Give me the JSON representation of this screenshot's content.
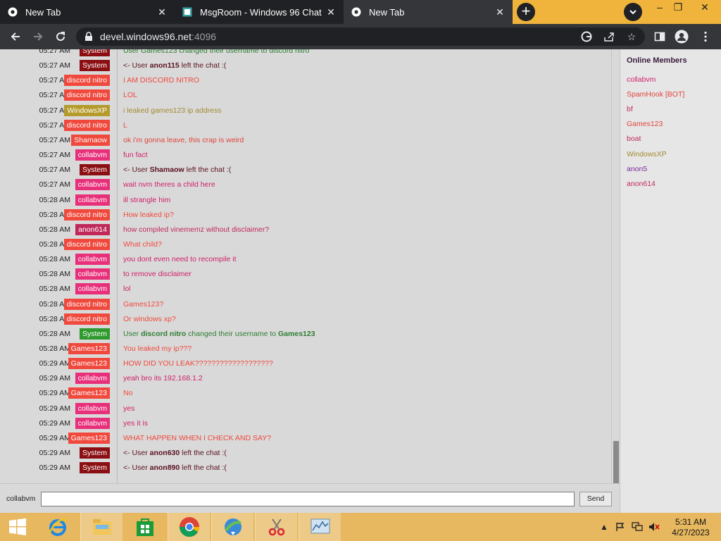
{
  "browser": {
    "tabs": [
      {
        "label": "New Tab",
        "active": false
      },
      {
        "label": "MsgRoom - Windows 96 Chat",
        "active": false
      },
      {
        "label": "New Tab",
        "active": true
      }
    ],
    "url_host": "devel.windows96.net",
    "url_port": ":4096"
  },
  "chat": {
    "messages": [
      {
        "time": "05:27 AM",
        "user": "System",
        "user_color": "#8b0e12",
        "text": "User Games123 changed their username to discord nitro",
        "text_color": "#2e7d32",
        "partial": true
      },
      {
        "time": "05:27 AM",
        "user": "System",
        "user_color": "#8b0e12",
        "pre": "<- User ",
        "bold": "anon115",
        "post": " left the chat :(",
        "text_color": "#5a1020"
      },
      {
        "time": "05:27 AM",
        "user": "discord nitro",
        "user_color": "#f0483c",
        "text": "I AM DISCORD NITRO",
        "text_color": "#f0483c"
      },
      {
        "time": "05:27 AM",
        "user": "discord nitro",
        "user_color": "#f0483c",
        "text": "LOL",
        "text_color": "#f0483c"
      },
      {
        "time": "05:27 AM",
        "user": "WindowsXP",
        "user_color": "#b59a2c",
        "text": "i leaked games123 ip address",
        "text_color": "#a08a30"
      },
      {
        "time": "05:27 AM",
        "user": "discord nitro",
        "user_color": "#f0483c",
        "text": "L",
        "text_color": "#f0483c"
      },
      {
        "time": "05:27 AM",
        "user": "Shamaow",
        "user_color": "#f0483c",
        "text": "ok i'm gonna leave, this crap is weird",
        "text_color": "#e0443c"
      },
      {
        "time": "05:27 AM",
        "user": "collabvm",
        "user_color": "#e8307a",
        "text": "fun fact",
        "text_color": "#d0206a"
      },
      {
        "time": "05:27 AM",
        "user": "System",
        "user_color": "#8b0e12",
        "pre": "<- User ",
        "bold": "Shamaow",
        "post": " left the chat :(",
        "text_color": "#5a1020"
      },
      {
        "time": "05:27 AM",
        "user": "collabvm",
        "user_color": "#e8307a",
        "text": "wait nvm theres a child here",
        "text_color": "#d0206a"
      },
      {
        "time": "05:28 AM",
        "user": "collabvm",
        "user_color": "#e8307a",
        "text": "ill strangle him",
        "text_color": "#d0206a"
      },
      {
        "time": "05:28 AM",
        "user": "discord nitro",
        "user_color": "#f0483c",
        "text": "How leaked ip?",
        "text_color": "#f0483c"
      },
      {
        "time": "05:28 AM",
        "user": "anon614",
        "user_color": "#c0285a",
        "text": "how compiled vinememz without disclaimer?",
        "text_color": "#c0285a"
      },
      {
        "time": "05:28 AM",
        "user": "discord nitro",
        "user_color": "#f0483c",
        "text": "What child?",
        "text_color": "#f0483c"
      },
      {
        "time": "05:28 AM",
        "user": "collabvm",
        "user_color": "#e8307a",
        "text": "you dont even need to recompile it",
        "text_color": "#d0206a"
      },
      {
        "time": "05:28 AM",
        "user": "collabvm",
        "user_color": "#e8307a",
        "text": "to remove disclaimer",
        "text_color": "#d0206a"
      },
      {
        "time": "05:28 AM",
        "user": "collabvm",
        "user_color": "#e8307a",
        "text": "lol",
        "text_color": "#d0206a"
      },
      {
        "time": "05:28 AM",
        "user": "discord nitro",
        "user_color": "#f0483c",
        "text": "Games123?",
        "text_color": "#f0483c"
      },
      {
        "time": "05:28 AM",
        "user": "discord nitro",
        "user_color": "#f0483c",
        "text": "Or windows xp?",
        "text_color": "#f0483c"
      },
      {
        "time": "05:28 AM",
        "user": "System",
        "user_color": "#2e9a2e",
        "pre": "User ",
        "bold": "discord nitro",
        "mid": "  changed their username to ",
        "bold2": "Games123",
        "post": "",
        "text_color": "#2e7d32"
      },
      {
        "time": "05:28 AM",
        "user": "Games123",
        "user_color": "#f0483c",
        "text": "You leaked my ip???",
        "text_color": "#f0483c"
      },
      {
        "time": "05:29 AM",
        "user": "Games123",
        "user_color": "#f0483c",
        "text": "HOW DID YOU LEAK???????????????????",
        "text_color": "#f0483c"
      },
      {
        "time": "05:29 AM",
        "user": "collabvm",
        "user_color": "#e8307a",
        "text": "yeah bro its 192.168.1.2",
        "text_color": "#d0206a"
      },
      {
        "time": "05:29 AM",
        "user": "Games123",
        "user_color": "#f0483c",
        "text": "No",
        "text_color": "#f0483c"
      },
      {
        "time": "05:29 AM",
        "user": "collabvm",
        "user_color": "#e8307a",
        "text": "yes",
        "text_color": "#d0206a"
      },
      {
        "time": "05:29 AM",
        "user": "collabvm",
        "user_color": "#e8307a",
        "text": "yes it is",
        "text_color": "#d0206a"
      },
      {
        "time": "05:29 AM",
        "user": "Games123",
        "user_color": "#f0483c",
        "text": "WHAT HAPPEN WHEN I CHECK AND SAY?",
        "text_color": "#f0483c"
      },
      {
        "time": "05:29 AM",
        "user": "System",
        "user_color": "#8b0e12",
        "pre": "<- User ",
        "bold": "anon630",
        "post": " left the chat :(",
        "text_color": "#5a1020"
      },
      {
        "time": "05:29 AM",
        "user": "System",
        "user_color": "#8b0e12",
        "pre": "<- User ",
        "bold": "anon890",
        "post": " left the chat :(",
        "text_color": "#5a1020"
      }
    ],
    "nick": "collabvm",
    "input_value": "",
    "send_label": "Send"
  },
  "members": {
    "heading": "Online Members",
    "list": [
      {
        "name": "collabvm",
        "color": "#d0206a"
      },
      {
        "name": "SpamHook [BOT]",
        "color": "#e0443c"
      },
      {
        "name": "bf",
        "color": "#c0285a"
      },
      {
        "name": "Games123",
        "color": "#e0443c"
      },
      {
        "name": "boat",
        "color": "#c0285a"
      },
      {
        "name": "WindowsXP",
        "color": "#a08a30"
      },
      {
        "name": "anon5",
        "color": "#7a2a9a"
      },
      {
        "name": "anon614",
        "color": "#c0285a"
      }
    ]
  },
  "taskbar": {
    "time": "5:31 AM",
    "date": "4/27/2023"
  }
}
